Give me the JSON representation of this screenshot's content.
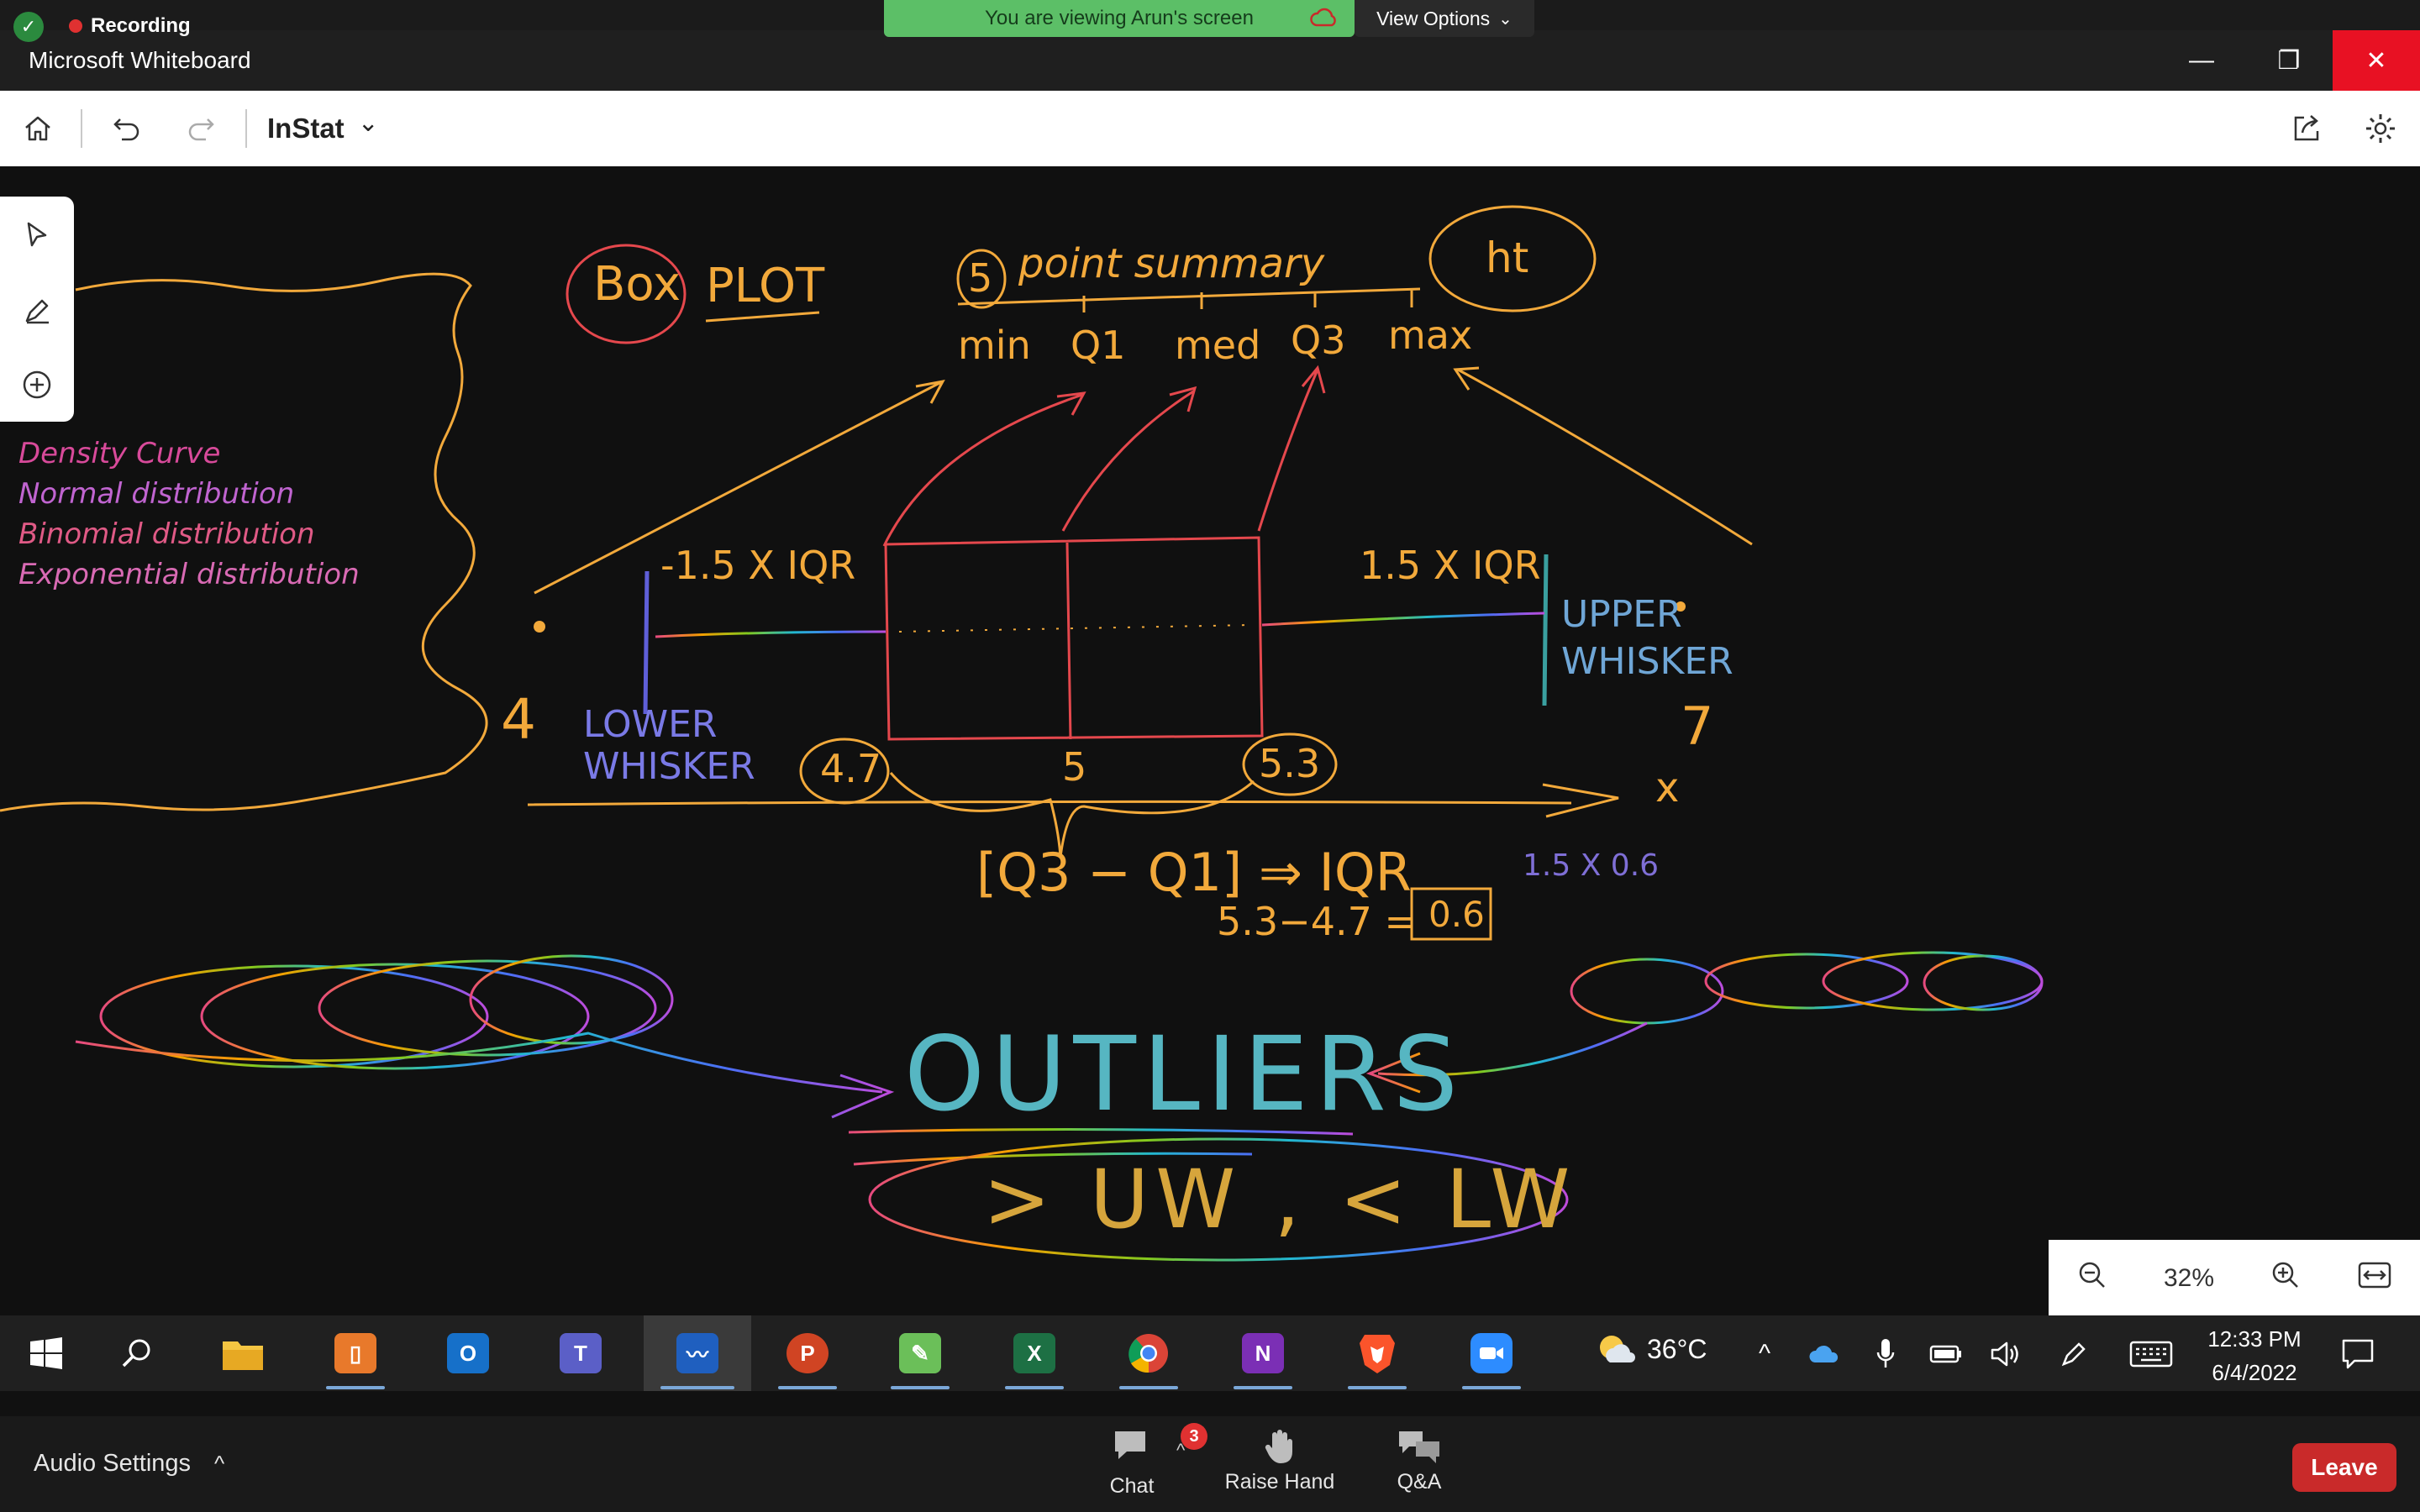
{
  "zoom_top": {
    "recording_label": "Recording",
    "viewing_banner": "You are viewing Arun's screen",
    "view_options_label": "View Options"
  },
  "window": {
    "title": "Microsoft Whiteboard",
    "minimize_glyph": "—",
    "restore_glyph": "❐",
    "close_glyph": "✕"
  },
  "toolbar": {
    "board_name": "InStat",
    "chevron_glyph": "⌄"
  },
  "board": {
    "topics": [
      "Density Curve",
      "Normal distribution",
      "Binomial distribution",
      "Exponential distribution"
    ],
    "box_label": "Box",
    "plot_label": "PLOT",
    "five_label": "5",
    "summary_label": "point summary",
    "ht_label": "ht",
    "summary_items": [
      "min",
      "Q1",
      "med",
      "Q3",
      "max"
    ],
    "lower_fence": "-1.5 X IQR",
    "upper_fence": "1.5 X IQR",
    "upper_whisker": "UPPER WHISKER",
    "lower_whisker": "LOWER WHISKER",
    "axis_min": "4",
    "axis_max": "7",
    "q1_value": "4.7",
    "median_value": "5",
    "q3_value": "5.3",
    "axis_x": "x",
    "iqr_formula": "[Q3 − Q1] ⇒ IQR",
    "iqr_calc": "5.3−4.7 =",
    "iqr_result": "0.6",
    "fence_calc": "1.5 X 0.6",
    "outliers": "OUTLIERS",
    "outlier_rule": "> UW , < LW"
  },
  "zoom_control": {
    "level": "32%"
  },
  "taskbar": {
    "temperature": "36°C",
    "time": "12:33 PM",
    "date": "6/4/2022",
    "apps": [
      {
        "icon": "file-explorer-icon"
      },
      {
        "icon": "phone-link-icon"
      },
      {
        "icon": "outlook-icon",
        "letter": "O"
      },
      {
        "icon": "teams-icon",
        "letter": "T"
      },
      {
        "icon": "whiteboard-icon"
      },
      {
        "icon": "powerpoint-icon",
        "letter": "P"
      },
      {
        "icon": "paint-icon"
      },
      {
        "icon": "excel-icon",
        "letter": "X"
      },
      {
        "icon": "chrome-icon"
      },
      {
        "icon": "onenote-icon",
        "letter": "N"
      },
      {
        "icon": "brave-icon"
      },
      {
        "icon": "zoom-app-icon"
      }
    ]
  },
  "zoom_bottom": {
    "audio_settings": "Audio Settings",
    "chat_label": "Chat",
    "chat_count": "3",
    "raise_hand_label": "Raise Hand",
    "qa_label": "Q&A",
    "leave_label": "Leave"
  }
}
